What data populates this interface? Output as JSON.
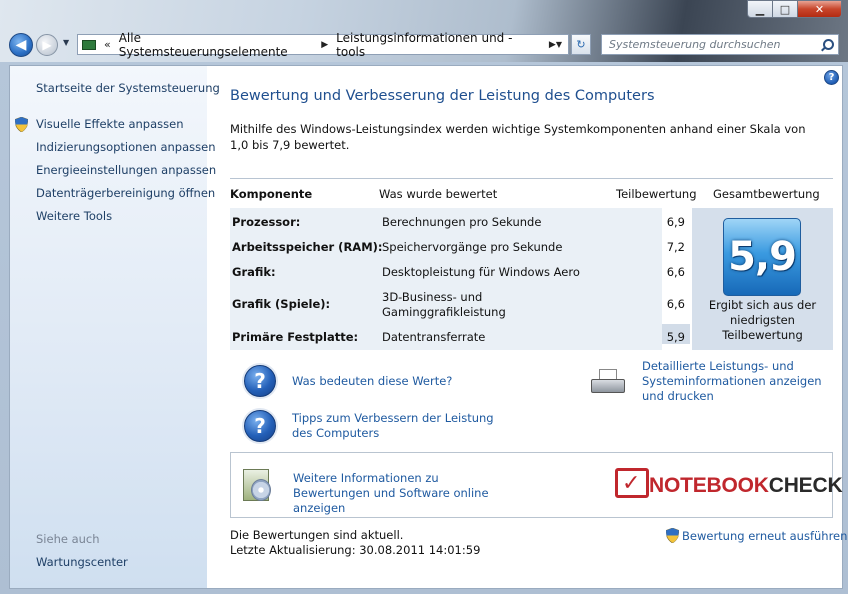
{
  "window": {
    "minimize_glyph": "▁",
    "maximize_glyph": "□",
    "close_glyph": "✕"
  },
  "navigation": {
    "back_glyph": "◀",
    "forward_glyph": "▶",
    "dropdown_glyph": "▼",
    "address_chevron": "«",
    "breadcrumbs": [
      "Alle Systemsteuerungselemente",
      "Leistungsinformationen und -tools"
    ],
    "breadcrumb_separator": "▶",
    "address_dropdown_glyph": "▼",
    "refresh_glyph": "↻",
    "search_placeholder": "Systemsteuerung durchsuchen"
  },
  "sidebar": {
    "home_link": "Startseite der Systemsteuerung",
    "tasks": [
      {
        "label": "Visuelle Effekte anpassen",
        "shield": true
      },
      {
        "label": "Indizierungsoptionen anpassen",
        "shield": false
      },
      {
        "label": "Energieeinstellungen anpassen",
        "shield": false
      },
      {
        "label": "Datenträgerbereinigung öffnen",
        "shield": false
      },
      {
        "label": "Weitere Tools",
        "shield": false
      }
    ],
    "see_also_heading": "Siehe auch",
    "see_also_links": [
      "Wartungscenter"
    ]
  },
  "main": {
    "help_glyph": "?",
    "title": "Bewertung und Verbesserung der Leistung des Computers",
    "intro": "Mithilfe des Windows-Leistungsindex werden wichtige Systemkomponenten anhand einer Skala von 1,0 bis 7,9 bewertet.",
    "table": {
      "headers": {
        "component": "Komponente",
        "rated": "Was wurde bewertet",
        "subscore": "Teilbewertung",
        "basescore": "Gesamtbewertung"
      },
      "rows": [
        {
          "component": "Prozessor:",
          "rated": "Berechnungen pro Sekunde",
          "subscore": "6,9"
        },
        {
          "component": "Arbeitsspeicher (RAM):",
          "rated": "Speichervorgänge pro Sekunde",
          "subscore": "7,2"
        },
        {
          "component": "Grafik:",
          "rated": "Desktopleistung für Windows Aero",
          "subscore": "6,6"
        },
        {
          "component": "Grafik (Spiele):",
          "rated": "3D-Business- und Gaminggrafikleistung",
          "subscore": "6,6"
        },
        {
          "component": "Primäre Festplatte:",
          "rated": "Datentransferrate",
          "subscore": "5,9"
        }
      ],
      "base_score": "5,9",
      "base_score_caption": "Ergibt sich aus der niedrigsten Teilbewertung"
    },
    "links": {
      "what_do_mean": "Was bedeuten diese Werte?",
      "tips": "Tipps zum Verbessern der Leistung des Computers",
      "details": "Detaillierte Leistungs- und Systeminformationen anzeigen und drucken",
      "more_info": "Weitere Informationen zu Bewertungen und Software online anzeigen",
      "question_glyph": "?"
    },
    "branding": {
      "logo_prefix": "NOTEBOOK",
      "logo_suffix": "CHECK",
      "check_mark": "✓"
    },
    "status": {
      "current": "Die Bewertungen sind aktuell.",
      "last_update_label": "Letzte Aktualisierung:",
      "last_update_value": "30.08.2011 14:01:59"
    },
    "rerun_label": "Bewertung erneut ausführen"
  },
  "colors": {
    "link": "#1f5aa0",
    "title": "#1f4f8f",
    "brand_red": "#c0272d"
  }
}
